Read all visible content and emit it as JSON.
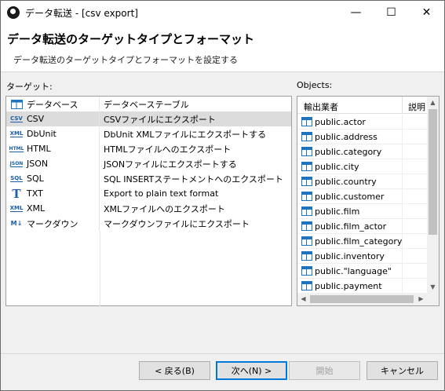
{
  "window": {
    "title": "データ転送 - [csv export]",
    "minimize": "—",
    "maximize": "☐",
    "close": "✕"
  },
  "header": {
    "title": "データ転送のターゲットタイプとフォーマット",
    "subtitle": "データ転送のターゲットタイプとフォーマットを設定する"
  },
  "targets": {
    "label": "ターゲット:",
    "selected_index": 1,
    "rows": [
      {
        "icon": "database-table-icon",
        "name": "データベース",
        "desc": "データベーステーブル"
      },
      {
        "icon": "csv-file-icon",
        "name": "CSV",
        "desc": "CSVファイルにエクスポート"
      },
      {
        "icon": "xml-file-icon",
        "name": "DbUnit",
        "desc": "DbUnit XMLファイルにエクスポートする"
      },
      {
        "icon": "html-file-icon",
        "name": "HTML",
        "desc": "HTMLファイルへのエクスポート"
      },
      {
        "icon": "json-file-icon",
        "name": "JSON",
        "desc": "JSONファイルにエクスポートする"
      },
      {
        "icon": "sql-file-icon",
        "name": "SQL",
        "desc": "SQL INSERTステートメントへのエクスポート"
      },
      {
        "icon": "text-file-icon",
        "name": "TXT",
        "desc": "Export to plain text format"
      },
      {
        "icon": "xml-file-icon",
        "name": "XML",
        "desc": "XMLファイルへのエクスポート"
      },
      {
        "icon": "markdown-icon",
        "name": "マークダウン",
        "desc": "マークダウンファイルにエクスポート"
      }
    ]
  },
  "objects": {
    "label": "Objects:",
    "col_source": "輸出業者",
    "col_desc": "説明",
    "rows": [
      "public.actor",
      "public.address",
      "public.category",
      "public.city",
      "public.country",
      "public.customer",
      "public.film",
      "public.film_actor",
      "public.film_category",
      "public.inventory",
      "public.\"language\"",
      "public.payment"
    ]
  },
  "buttons": {
    "back": "< 戻る(B)",
    "next": "次へ(N) >",
    "finish": "開始",
    "cancel": "キャンセル"
  }
}
